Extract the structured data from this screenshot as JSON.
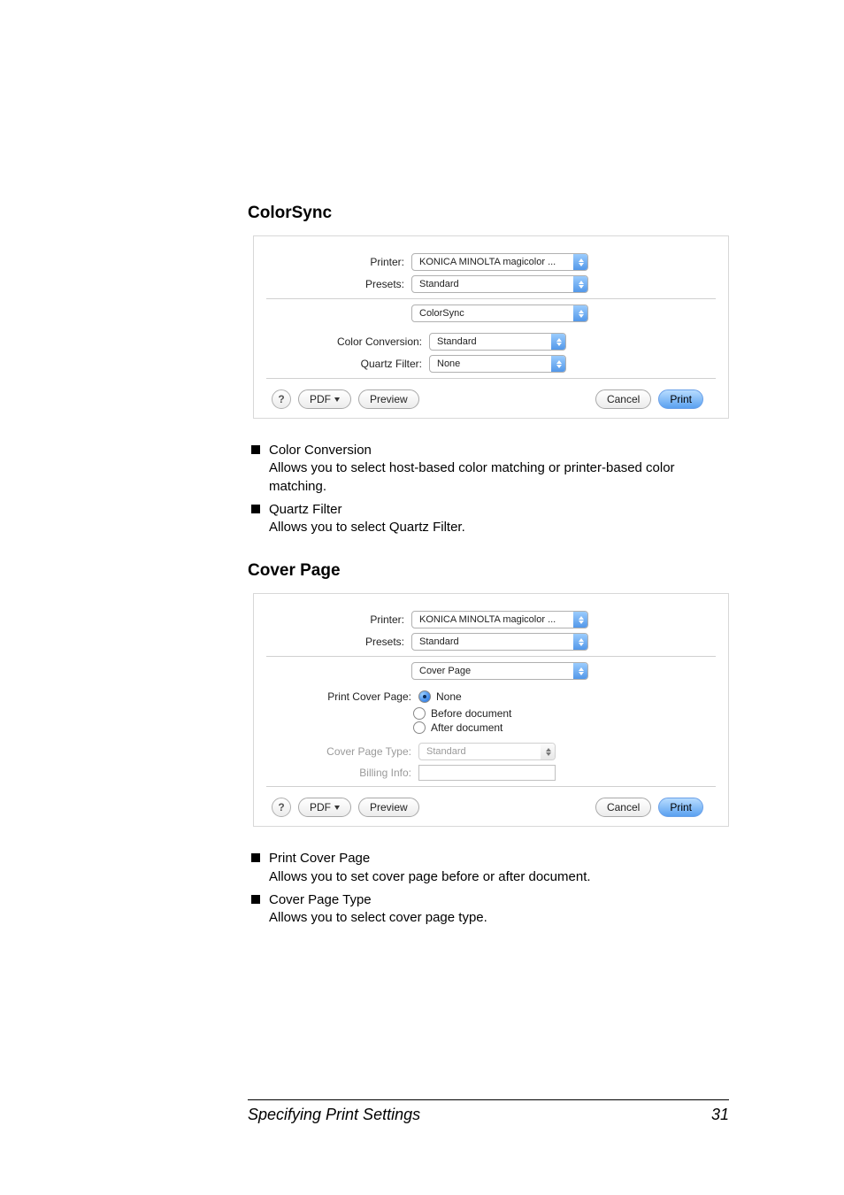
{
  "sections": {
    "colorsync": {
      "heading": "ColorSync",
      "dialog": {
        "printer_label": "Printer:",
        "printer_value": "KONICA MINOLTA magicolor ...",
        "presets_label": "Presets:",
        "presets_value": "Standard",
        "pane_value": "ColorSync",
        "color_conversion_label": "Color Conversion:",
        "color_conversion_value": "Standard",
        "quartz_filter_label": "Quartz Filter:",
        "quartz_filter_value": "None",
        "help_label": "?",
        "pdf_label": "PDF",
        "preview_label": "Preview",
        "cancel_label": "Cancel",
        "print_label": "Print"
      },
      "bullets": [
        {
          "title": "Color Conversion",
          "desc": "Allows you to select host-based color matching or printer-based color matching."
        },
        {
          "title": "Quartz Filter",
          "desc": "Allows you to select Quartz Filter."
        }
      ]
    },
    "coverpage": {
      "heading": "Cover Page",
      "dialog": {
        "printer_label": "Printer:",
        "printer_value": "KONICA MINOLTA magicolor ...",
        "presets_label": "Presets:",
        "presets_value": "Standard",
        "pane_value": "Cover Page",
        "print_cover_page_label": "Print Cover Page:",
        "radio_none": "None",
        "radio_before": "Before document",
        "radio_after": "After document",
        "cover_page_type_label": "Cover Page Type:",
        "cover_page_type_value": "Standard",
        "billing_info_label": "Billing Info:",
        "billing_info_value": "",
        "help_label": "?",
        "pdf_label": "PDF",
        "preview_label": "Preview",
        "cancel_label": "Cancel",
        "print_label": "Print"
      },
      "bullets": [
        {
          "title": "Print Cover Page",
          "desc": "Allows you to set cover page before or after document."
        },
        {
          "title": "Cover Page Type",
          "desc": "Allows you to select cover page type."
        }
      ]
    }
  },
  "footer": {
    "title": "Specifying Print Settings",
    "page": "31"
  }
}
